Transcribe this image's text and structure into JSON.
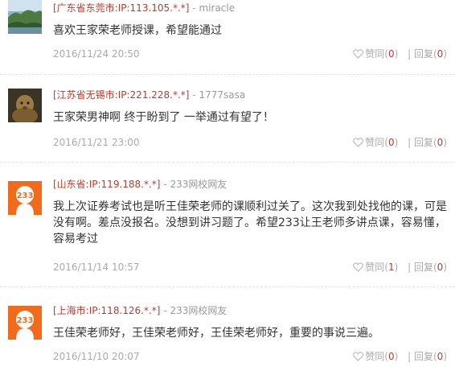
{
  "comments": [
    {
      "location": "[广东省东莞市:IP:113.105.*.*]",
      "separator": "-",
      "username": "miracle",
      "text": "喜欢王家荣老师授课，希望能通过",
      "date": "2016/11/24 20:50",
      "like_label": "赞同",
      "like_count": "0",
      "reply_label": "回复",
      "reply_count": "0",
      "avatar": "landscape-photo"
    },
    {
      "location": "[江苏省无锡市:IP:221.228.*.*]",
      "separator": "-",
      "username": "1777sasa",
      "text": "王家荣男神啊 终于盼到了 一举通过有望了！",
      "date": "2016/11/21 23:00",
      "like_label": "赞同",
      "like_count": "0",
      "reply_label": "回复",
      "reply_count": "0",
      "avatar": "animal-photo"
    },
    {
      "location": "[山东省:IP:119.188.*.*]",
      "separator": "-",
      "username": "233网校网友",
      "text": "我上次证券考试也是听王佳荣老师的课顺利过关了。这次我到处找他的课，可是没有啊。差点没报名。没想到讲习题了。希望233让王老师多讲点课，容易懂，容易考过",
      "date": "2016/11/14 10:57",
      "like_label": "赞同",
      "like_count": "1",
      "reply_label": "回复",
      "reply_count": "0",
      "avatar": "233-logo",
      "avatar_text": "233"
    },
    {
      "location": "[上海市:IP:118.126.*.*]",
      "separator": "-",
      "username": "233网校网友",
      "text": "王佳荣老师好，王佳荣老师好，王佳荣老师好，重要的事说三遍。",
      "date": "2016/11/10 20:07",
      "like_label": "赞同",
      "like_count": "0",
      "reply_label": "回复",
      "reply_count": "0",
      "avatar": "233-logo",
      "avatar_text": "233"
    }
  ],
  "colors": {
    "location": "#c0392b",
    "count": "#c0392b",
    "muted": "#aaaaaa",
    "text": "#333333",
    "logo_orange": "#f26a1b"
  }
}
